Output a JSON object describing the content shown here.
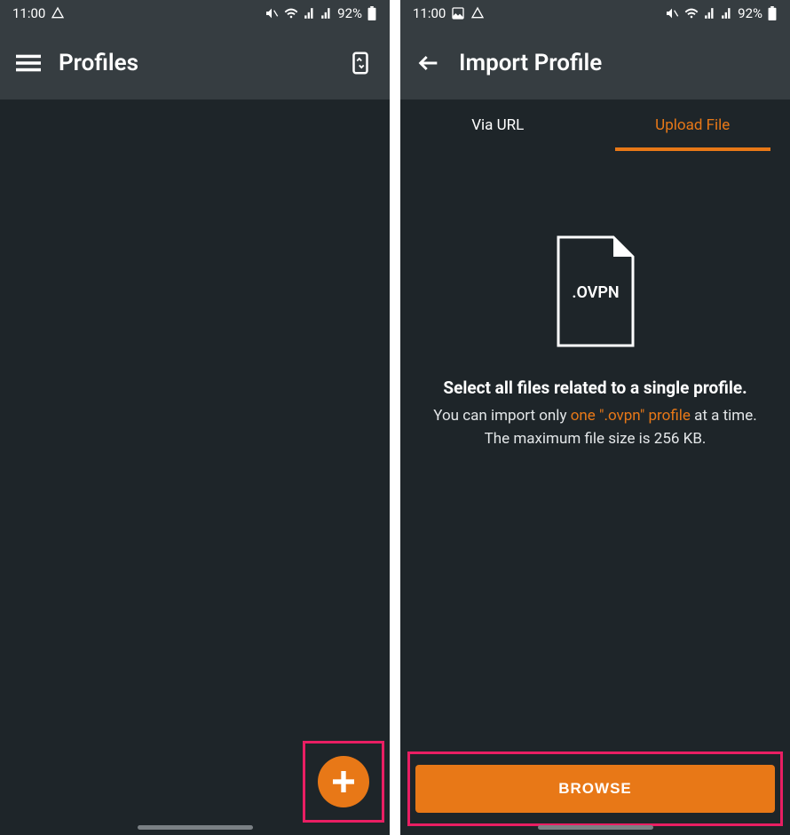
{
  "status": {
    "time": "11:00",
    "battery": "92%"
  },
  "screen1": {
    "title": "Profiles"
  },
  "screen2": {
    "title": "Import Profile",
    "tabs": {
      "url": "Via URL",
      "upload": "Upload File"
    },
    "fileLabel": ".OVPN",
    "heading": "Select all files related to a single profile.",
    "line1_pre": "You can import only ",
    "line1_highlight": "one \".ovpn\" profile",
    "line1_post": " at a time.",
    "line2": "The maximum file size is 256 KB.",
    "browseLabel": "BROWSE"
  }
}
